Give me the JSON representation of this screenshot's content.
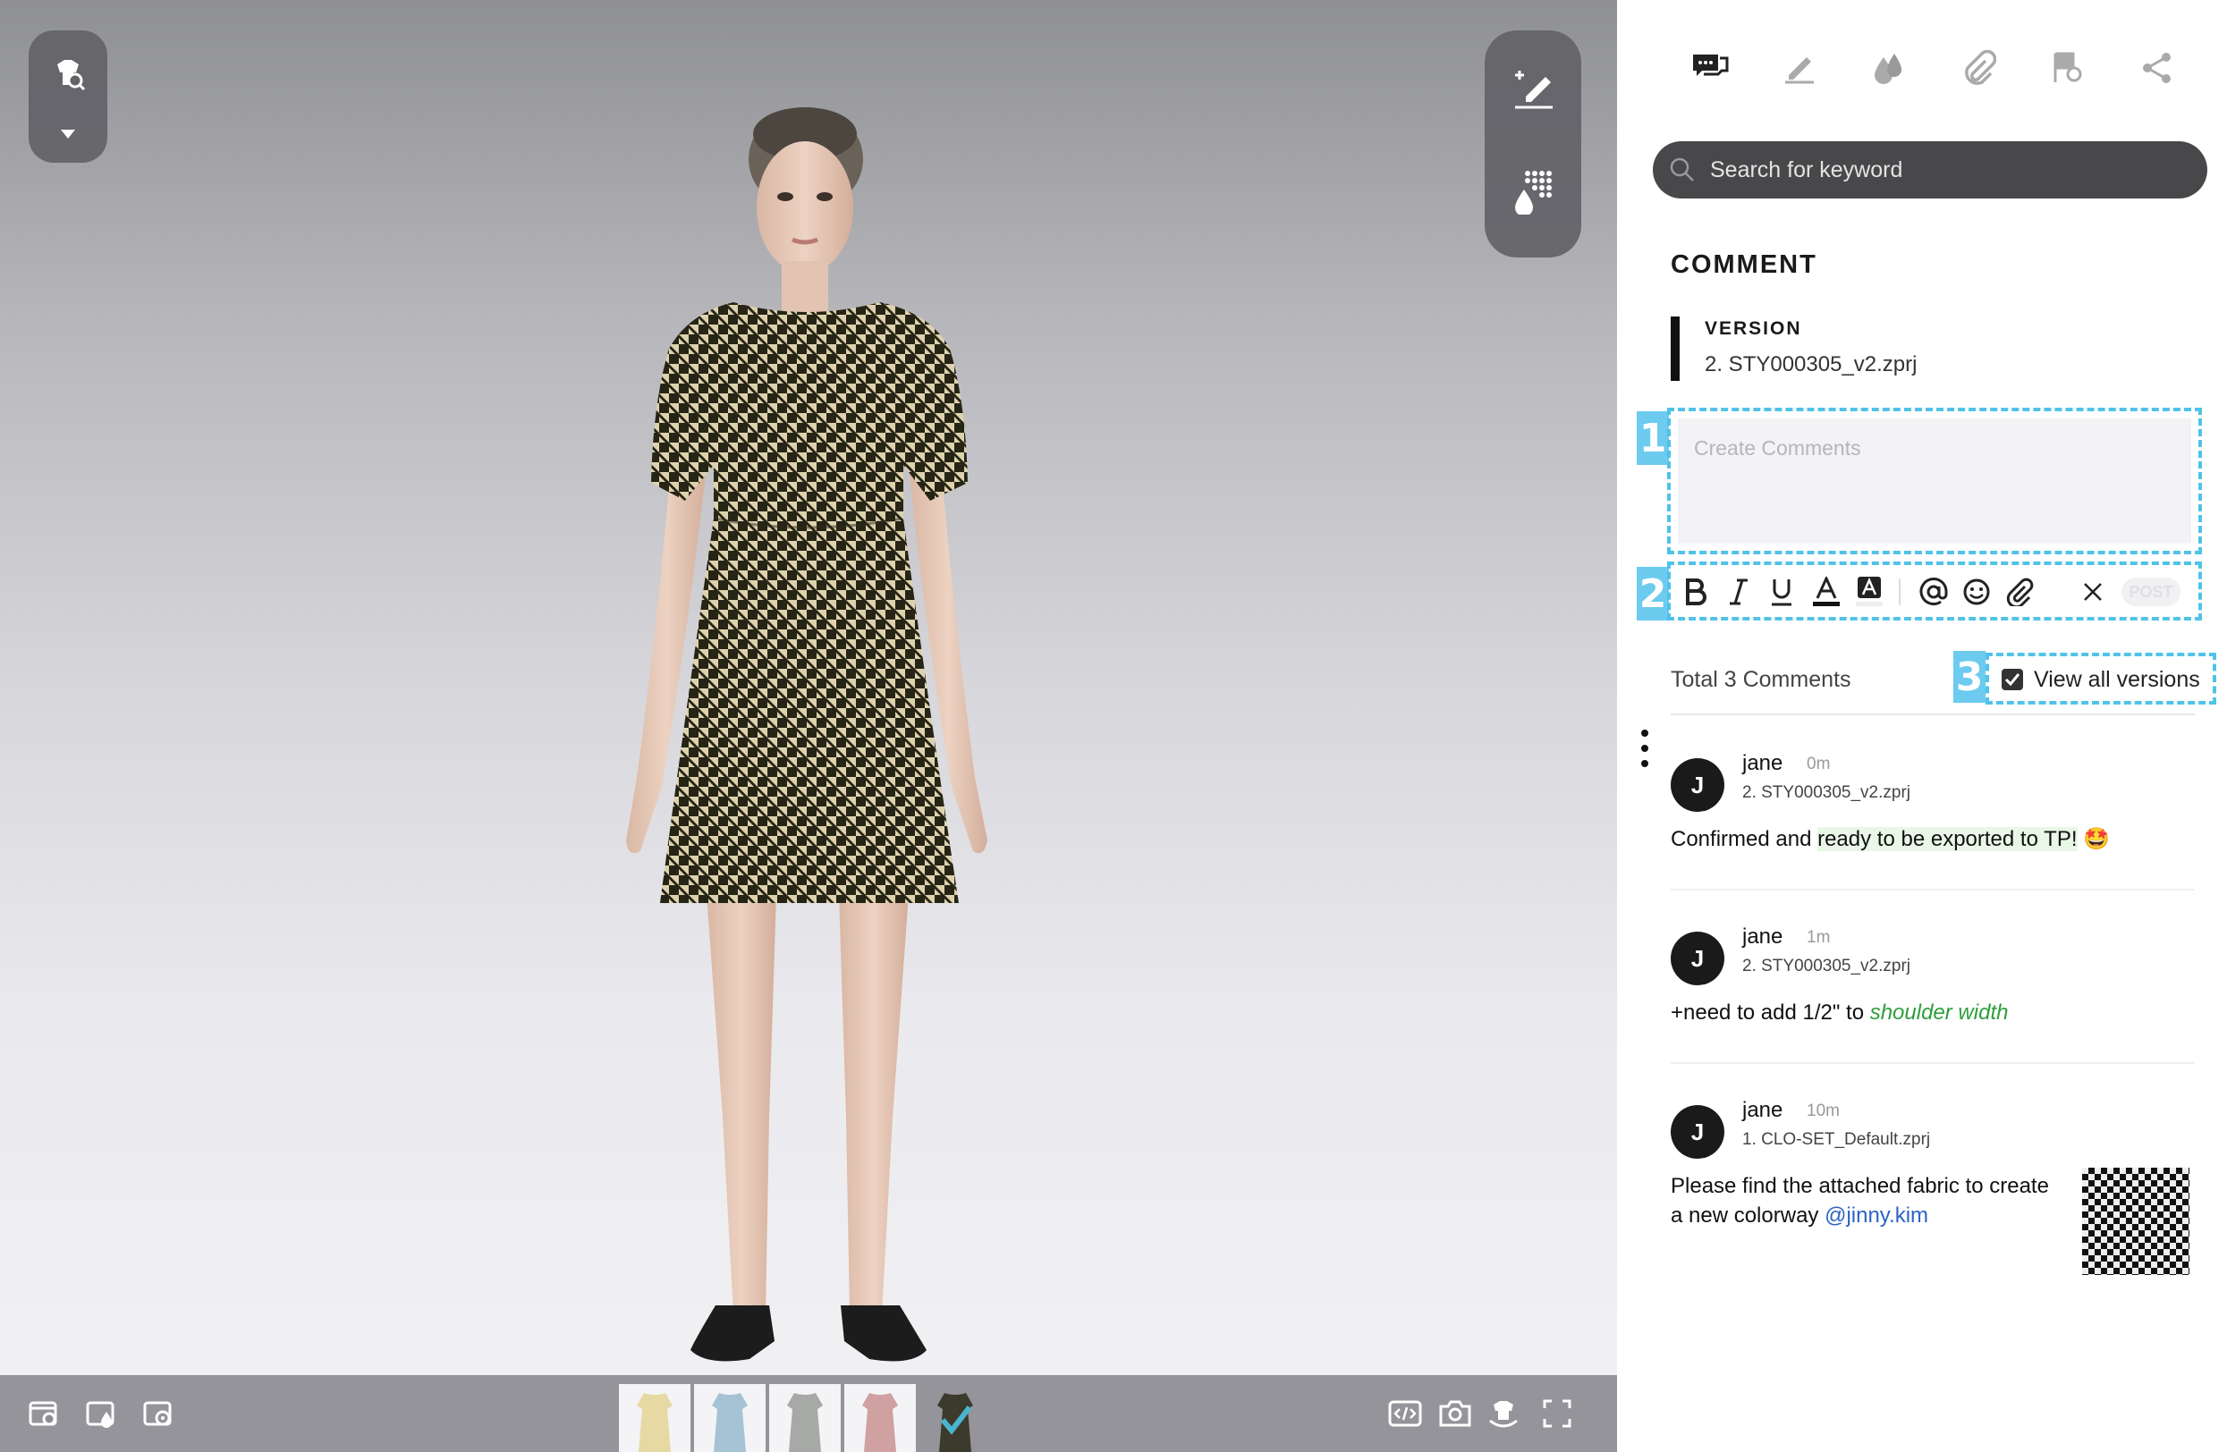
{
  "viewer": {
    "left_tools": {
      "icon_main": "garment-search-icon",
      "icon_sub": "caret-down-icon"
    },
    "right_tools": {
      "items": [
        {
          "icon": "add-annotation-icon"
        },
        {
          "icon": "colorway-grid-icon"
        }
      ]
    },
    "bottom_left_icons": [
      "viewer-settings-icon",
      "fabric-view-icon",
      "avatar-view-icon"
    ],
    "bottom_right_icons": [
      "embed-code-icon",
      "camera-icon",
      "turntable-capture-icon",
      "fullscreen-icon"
    ],
    "colorways": [
      {
        "name": "yellow",
        "color": "#e7d9a4"
      },
      {
        "name": "blue",
        "color": "#a6c3d6"
      },
      {
        "name": "gray",
        "color": "#a7a9a6"
      },
      {
        "name": "rose",
        "color": "#cfa1a1"
      },
      {
        "name": "houndstooth",
        "color": "#3b3a2c",
        "selected": true
      }
    ],
    "accent": "#4ab4cf"
  },
  "panel": {
    "tabs": [
      {
        "icon": "comment-icon",
        "active": true
      },
      {
        "icon": "edit-pen-icon"
      },
      {
        "icon": "colorway-drops-icon"
      },
      {
        "icon": "attachment-icon"
      },
      {
        "icon": "flag-search-icon"
      },
      {
        "icon": "share-icon"
      }
    ],
    "search": {
      "placeholder": "Search for keyword"
    },
    "heading": "COMMENT",
    "version": {
      "label": "VERSION",
      "value": "2. STY000305_v2.zprj"
    },
    "comment_input": {
      "placeholder": "Create Comments"
    },
    "markers": [
      "1",
      "2",
      "3"
    ],
    "toolbar": {
      "items": [
        "bold-icon",
        "italic-icon",
        "underline-icon",
        "text-color-icon",
        "highlight-icon",
        "mention-icon",
        "emoji-icon",
        "attach-icon",
        "clear-icon"
      ],
      "post_label": "POST"
    },
    "total_comments": "Total 3 Comments",
    "view_all_versions": {
      "label": "View all versions",
      "checked": true
    },
    "comments": [
      {
        "avatar": "J",
        "author": "jane",
        "time": "0m",
        "version": "2. STY000305_v2.zprj",
        "body_a": "Confirmed and ",
        "body_b": "ready to be exported to TP!",
        "emoji": "🤩"
      },
      {
        "avatar": "J",
        "author": "jane",
        "time": "1m",
        "version": "2. STY000305_v2.zprj",
        "body_a": "+need to add 1/2\" to ",
        "body_b": "shoulder width"
      },
      {
        "avatar": "J",
        "author": "jane",
        "time": "10m",
        "version": "1. CLO-SET_Default.zprj",
        "body_line1": "Please find the attached fabric to create",
        "body_line2": "a new colorway ",
        "mention": "@jinny.kim",
        "attachment": "houndstooth-fabric-thumbnail"
      }
    ],
    "accent_dash": "#4fc3e8"
  }
}
